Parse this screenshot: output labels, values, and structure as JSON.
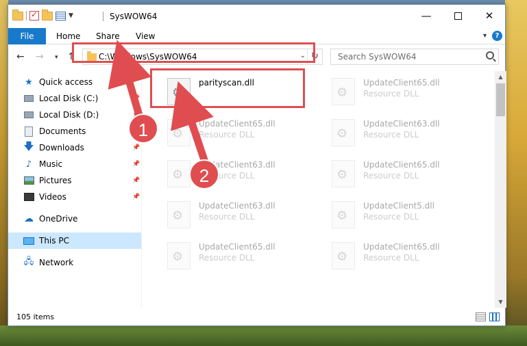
{
  "window": {
    "title": "SysWOW64",
    "minimize_glyph": "—",
    "close_glyph": "✕"
  },
  "ribbon": {
    "tabs": [
      {
        "label": "File"
      },
      {
        "label": "Home"
      },
      {
        "label": "Share"
      },
      {
        "label": "View"
      }
    ],
    "help_glyph": "?"
  },
  "address": {
    "path": "C:\\Windows\\SysWOW64",
    "search_placeholder": "Search SysWOW64"
  },
  "sidebar": {
    "items": [
      {
        "label": "Quick access",
        "icon": "star-icon",
        "pinned": false
      },
      {
        "label": "Local Disk (C:)",
        "icon": "disk-icon",
        "pinned": true
      },
      {
        "label": "Local Disk (D:)",
        "icon": "disk-icon",
        "pinned": true
      },
      {
        "label": "Documents",
        "icon": "documents-icon",
        "pinned": true
      },
      {
        "label": "Downloads",
        "icon": "download-icon",
        "pinned": true
      },
      {
        "label": "Music",
        "icon": "music-icon",
        "pinned": true
      },
      {
        "label": "Pictures",
        "icon": "pictures-icon",
        "pinned": true
      },
      {
        "label": "Videos",
        "icon": "videos-icon",
        "pinned": true
      },
      {
        "label": "OneDrive",
        "icon": "cloud-icon",
        "pinned": false
      },
      {
        "label": "This PC",
        "icon": "computer-icon",
        "pinned": false,
        "selected": true
      },
      {
        "label": "Network",
        "icon": "network-icon",
        "pinned": false
      }
    ]
  },
  "files": [
    {
      "name": "parityscan.dll",
      "type": "",
      "highlighted": true
    },
    {
      "name": "UpdateClient65.dll",
      "type": "Resource DLL"
    },
    {
      "name": "UpdateClient65.dll",
      "type": "Resource DLL"
    },
    {
      "name": "UpdateClient63.dll",
      "type": "Resource DLL"
    },
    {
      "name": "UpdateClient63.dll",
      "type": "Resource DLL"
    },
    {
      "name": "UpdateClient65.dll",
      "type": "Resource DLL"
    },
    {
      "name": "UpdateClient63.dll",
      "type": "Resource DLL"
    },
    {
      "name": "UpdateClient5.dll",
      "type": "Resource DLL"
    },
    {
      "name": "UpdateClient65.dll",
      "type": "Resource DLL"
    },
    {
      "name": "UpdateClient65.dll",
      "type": "Resource DLL"
    }
  ],
  "status": {
    "item_count": "105 items"
  },
  "annotations": {
    "step1": "1",
    "step2": "2",
    "color": "#e04d50"
  }
}
